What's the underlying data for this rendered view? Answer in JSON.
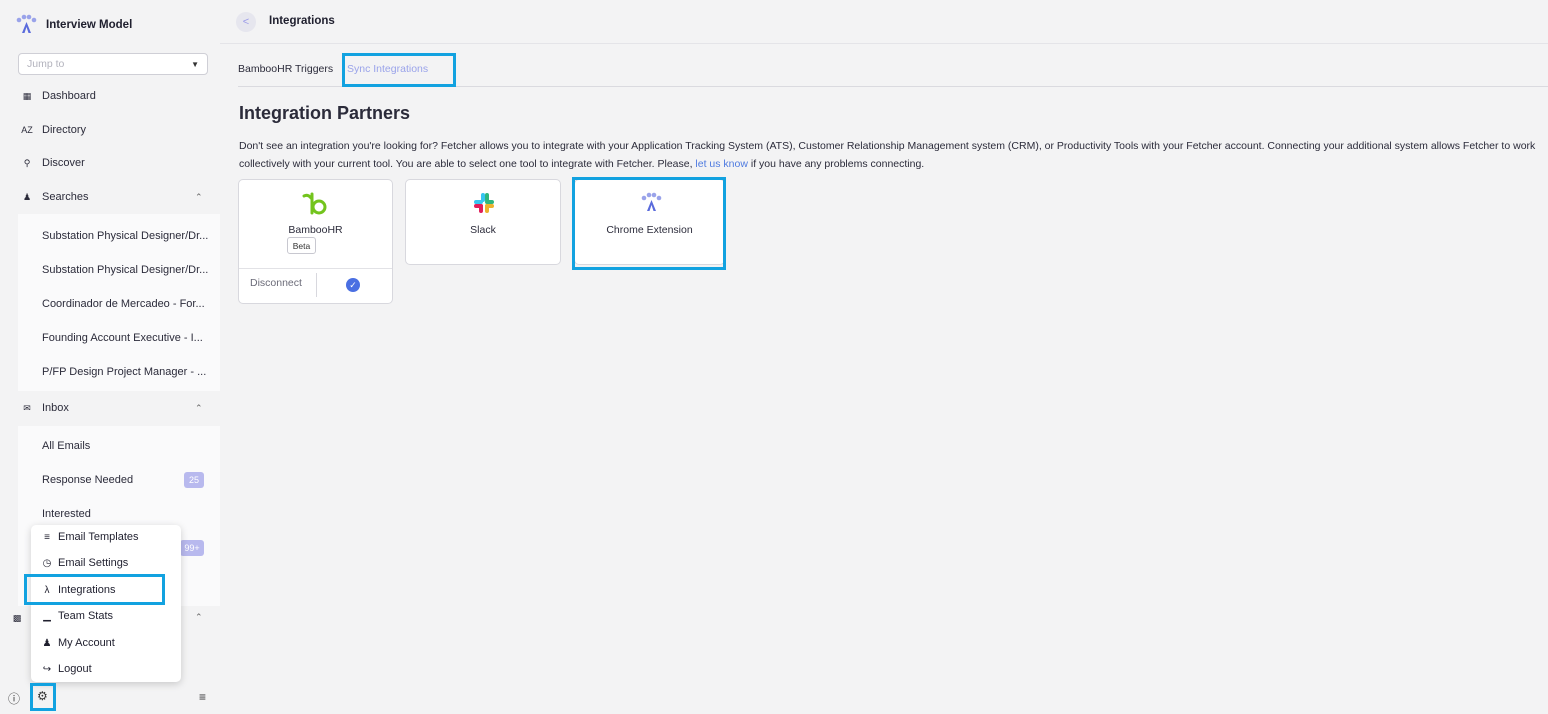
{
  "brand": {
    "name": "Interview Model",
    "icon": "paw-logo-icon"
  },
  "jump": {
    "placeholder": "Jump to"
  },
  "nav": {
    "dashboard": "Dashboard",
    "directory": "Directory",
    "discover": "Discover",
    "searches": "Searches",
    "inbox": "Inbox"
  },
  "searches": [
    "Substation Physical Designer/Dr...",
    "Substation Physical Designer/Dr...",
    "Coordinador de Mercadeo - For...",
    "Founding Account Executive - I...",
    "P/FP Design Project Manager - ..."
  ],
  "inbox": {
    "all_emails": "All Emails",
    "response_needed": "Response Needed",
    "response_needed_count": "25",
    "interested": "Interested",
    "hidden_count": "99+"
  },
  "settings_menu": {
    "email_templates": "Email Templates",
    "email_settings": "Email Settings",
    "integrations": "Integrations",
    "team_stats": "Team Stats",
    "my_account": "My Account",
    "logout": "Logout"
  },
  "header": {
    "title": "Integrations"
  },
  "tabs": {
    "bamboohr_triggers": "BambooHR Triggers",
    "sync_integrations": "Sync Integrations"
  },
  "page": {
    "heading": "Integration Partners",
    "desc_part1": "Don't see an integration you're looking for? Fetcher allows you to integrate with your Application Tracking System (ATS), Customer Relationship Management system (CRM), or Productivity Tools with your Fetcher account. Connecting your additional system allows Fetcher to work collectively with your current tool. You are able to select one tool to integrate with Fetcher. Please, ",
    "desc_link": "let us know",
    "desc_part2": " if you have any problems connecting."
  },
  "partners": {
    "bamboohr": {
      "name": "BambooHR",
      "badge": "Beta",
      "action": "Disconnect"
    },
    "slack": {
      "name": "Slack"
    },
    "chrome": {
      "name": "Chrome Extension"
    }
  },
  "colors": {
    "highlight": "#12a2e0",
    "accent": "#9aa3ea",
    "check": "#4a6fe2",
    "bamboo_green": "#73c41d"
  }
}
